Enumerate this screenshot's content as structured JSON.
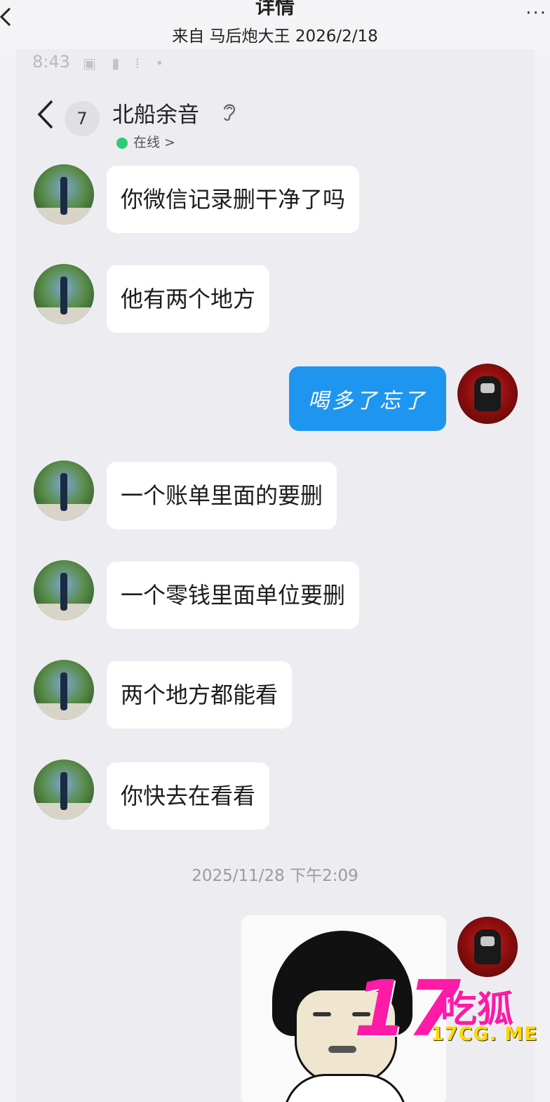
{
  "outer_header": {
    "back_icon": "chevron-left-icon",
    "title": "详情",
    "subtitle": "来自 马后炮大王 2026/2/18",
    "more_icon": "ellipsis-icon",
    "more_glyph": "···"
  },
  "phone_status": {
    "time": "8:43",
    "icons_glyph": "▣ ▮ ⁞ •"
  },
  "chat_header": {
    "back_icon": "chevron-left-icon",
    "unread_count": "7",
    "peer_name": "北船余音",
    "ear_icon_glyph": "𝒥",
    "online_status": "在线 >",
    "online_color": "#2ecc71"
  },
  "messages": [
    {
      "sender": "peer",
      "text": "你微信记录删干净了吗"
    },
    {
      "sender": "peer",
      "text": "他有两个地方"
    },
    {
      "sender": "me",
      "text": "喝多了忘了"
    },
    {
      "sender": "peer",
      "text": "一个账单里面的要删"
    },
    {
      "sender": "peer",
      "text": "一个零钱里面单位要删"
    },
    {
      "sender": "peer",
      "text": "两个地方都能看"
    },
    {
      "sender": "peer",
      "text": "你快去在看看"
    }
  ],
  "timestamp": "2025/11/28 下午2:09",
  "sticker": {
    "sender": "me",
    "description_icon": "mushroom-head-meme-sticker"
  },
  "watermark": {
    "number": "17",
    "brand_cn": "吃狐",
    "url": "17CG. ME",
    "color_primary": "#ff1aa8",
    "color_url": "#ffd800"
  },
  "colors": {
    "bubble_me": "#1e96f0",
    "bubble_peer": "#ffffff",
    "background": "#ededf1"
  }
}
